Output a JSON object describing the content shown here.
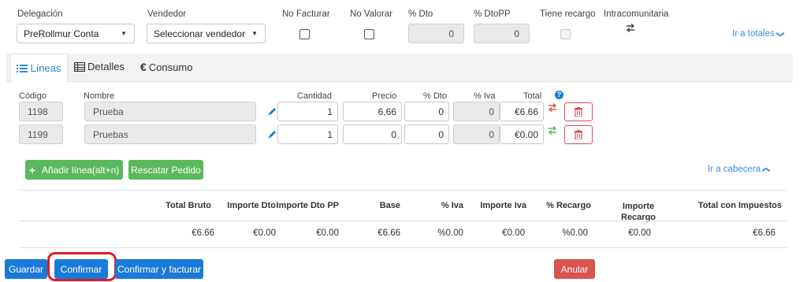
{
  "header": {
    "delegacion_label": "Delegación",
    "delegacion_value": "PreRollmur Conta",
    "vendedor_label": "Vendedor",
    "vendedor_value": "Seleccionar vendedor",
    "no_facturar_label": "No Facturar",
    "no_valorar_label": "No Valorar",
    "dto_label": "% Dto",
    "dto_value": "0",
    "dtopp_label": "% DtoPP",
    "dtopp_value": "0",
    "recargo_label": "Tiene recargo",
    "intracom_label": "Intracomunitaria",
    "ir_totales": "Ir a totales"
  },
  "tabs": [
    {
      "label": "Líneas",
      "icon": "list-icon",
      "active": true
    },
    {
      "label": "Detalles",
      "icon": "table-icon",
      "active": false
    },
    {
      "label": "Consumo",
      "icon": "euro-icon",
      "active": false
    }
  ],
  "lines": {
    "headers": {
      "codigo": "Código",
      "nombre": "Nombre",
      "cantidad": "Cantidad",
      "precio": "Precio",
      "dto": "% Dto",
      "iva": "% Iva",
      "total": "Total"
    },
    "rows": [
      {
        "codigo": "1198",
        "nombre": "Prueba",
        "cantidad": "1",
        "precio": "6,66",
        "dto": "0",
        "iva": "0",
        "total": "€6.66"
      },
      {
        "codigo": "1199",
        "nombre": "Pruebas",
        "cantidad": "1",
        "precio": "0",
        "dto": "0",
        "iva": "0",
        "total": "€0.00"
      }
    ],
    "add_line": "Añadir línea(alt+n)",
    "rescatar": "Rescatar Pedido",
    "ir_cabecera": "Ir a cabecera"
  },
  "totals": {
    "headers": [
      "Total Bruto",
      "Importe Dto",
      "Importe Dto PP",
      "Base",
      "% Iva",
      "Importe Iva",
      "% Recargo",
      "Importe Recargo",
      "Total con Impuestos"
    ],
    "values": [
      "€6.66",
      "€0.00",
      "€0.00",
      "€6.66",
      "%0.00",
      "€0.00",
      "%0.00",
      "€0.00",
      "€6.66"
    ]
  },
  "footer": {
    "guardar": "Guardar",
    "confirmar": "Confirmar",
    "confirmar_facturar": "Confirmar y facturar",
    "anular": "Anular"
  },
  "colors": {
    "accent": "#1a7ad9",
    "link": "#3a8ddb",
    "success": "#5cb85c",
    "danger": "#d9534f",
    "highlight": "#e01b24"
  }
}
